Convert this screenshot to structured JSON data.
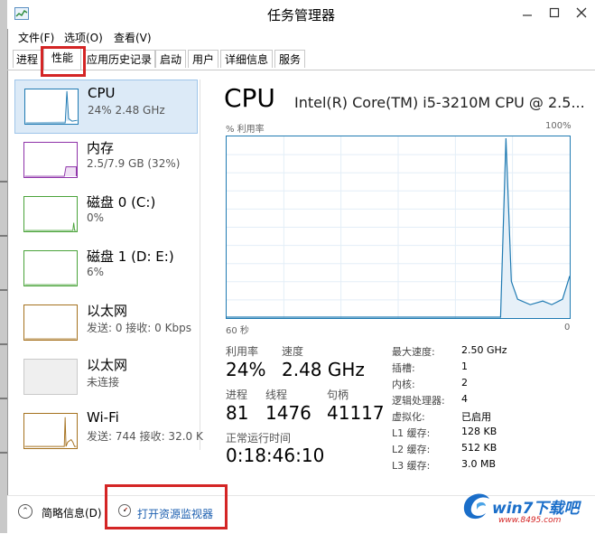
{
  "window": {
    "title": "任务管理器"
  },
  "menu": {
    "items": [
      "文件(F)",
      "选项(O)",
      "查看(V)"
    ]
  },
  "tabs": [
    "进程",
    "性能",
    "应用历史记录",
    "启动",
    "用户",
    "详细信息",
    "服务"
  ],
  "active_tab": "性能",
  "sidebar": {
    "items": [
      {
        "title": "CPU",
        "sub": "24% 2.48 GHz",
        "color": "#1f7ab2"
      },
      {
        "title": "内存",
        "sub": "2.5/7.9 GB (32%)",
        "color": "#8e32a9"
      },
      {
        "title": "磁盘 0 (C:)",
        "sub": "0%",
        "color": "#4aa33a"
      },
      {
        "title": "磁盘 1 (D: E:)",
        "sub": "6%",
        "color": "#4aa33a"
      },
      {
        "title": "以太网",
        "sub": "发送: 0 接收: 0 Kbps",
        "color": "#a5711e"
      },
      {
        "title": "以太网",
        "sub": "未连接",
        "color": "#c9c9c9"
      },
      {
        "title": "Wi-Fi",
        "sub": "发送: 744 接收: 32.0 K",
        "color": "#a5711e"
      }
    ]
  },
  "detail": {
    "title": "CPU",
    "model": "Intel(R) Core(TM) i5-3210M CPU @ 2.5...",
    "graph_top_left": "% 利用率",
    "graph_top_right": "100%",
    "graph_bottom_left": "60 秒",
    "graph_bottom_right": "0",
    "stats": {
      "utilization_label": "利用率",
      "utilization": "24%",
      "speed_label": "速度",
      "speed": "2.48 GHz",
      "processes_label": "进程",
      "processes": "81",
      "threads_label": "线程",
      "threads": "1476",
      "handles_label": "句柄",
      "handles": "41117",
      "uptime_label": "正常运行时间",
      "uptime": "0:18:46:10"
    },
    "specs": [
      {
        "label": "最大速度:",
        "value": "2.50 GHz"
      },
      {
        "label": "插槽:",
        "value": "1"
      },
      {
        "label": "内核:",
        "value": "2"
      },
      {
        "label": "逻辑处理器:",
        "value": "4"
      },
      {
        "label": "虚拟化:",
        "value": "已启用"
      },
      {
        "label": "L1 缓存:",
        "value": "128 KB"
      },
      {
        "label": "L2 缓存:",
        "value": "512 KB"
      },
      {
        "label": "L3 缓存:",
        "value": "3.0 MB"
      }
    ]
  },
  "footer": {
    "fewer_details": "简略信息(D)",
    "open_resmon": "打开资源监视器"
  },
  "watermark": {
    "text": "win7下载吧",
    "sub": "www.8495.com"
  }
}
